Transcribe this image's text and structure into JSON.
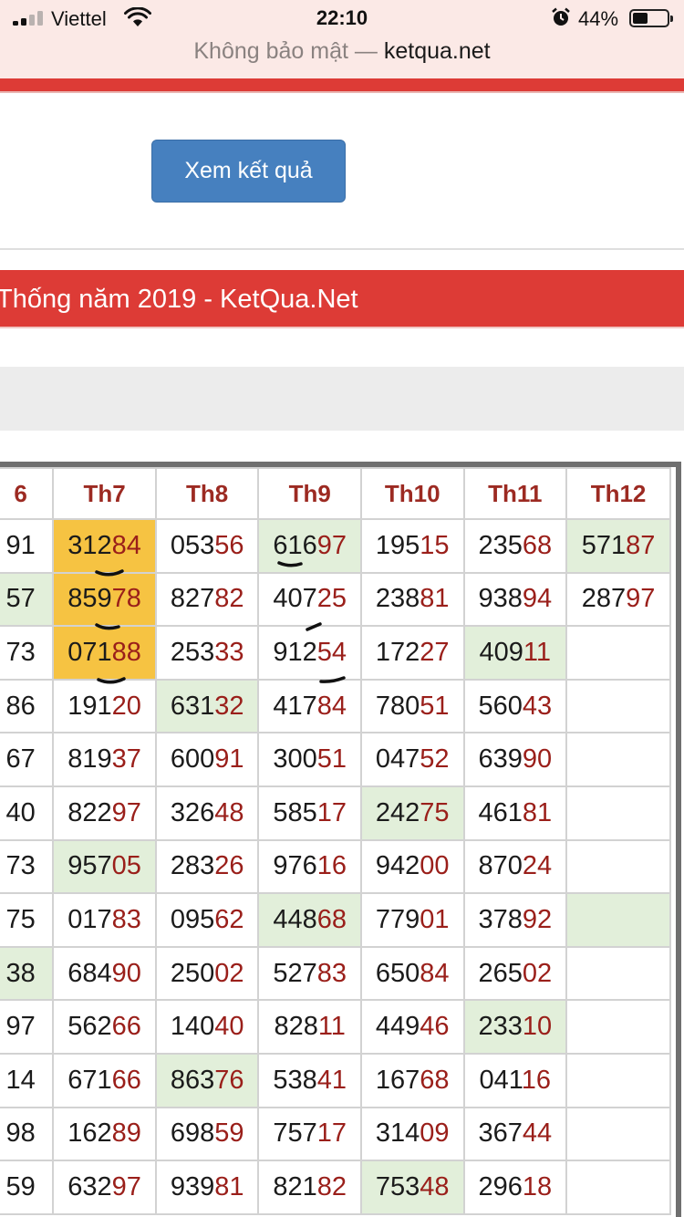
{
  "status": {
    "carrier": "Viettel",
    "time": "22:10",
    "battery": "44%",
    "icons": [
      "signal-icon",
      "wifi-icon",
      "alarm-icon",
      "battery-icon"
    ]
  },
  "browser": {
    "insecure_label": "Không bảo mật —",
    "domain": "ketqua.net"
  },
  "form": {
    "view_button_label": "Xem kết quả"
  },
  "section": {
    "title": "Thống năm 2019 - KetQua.Net"
  },
  "table": {
    "headers": [
      "6",
      "Th7",
      "Th8",
      "Th9",
      "Th10",
      "Th11",
      "Th12"
    ],
    "rows": [
      [
        {
          "v": "91",
          "b": ""
        },
        {
          "v": "312",
          "b": "84",
          "h": "yellow"
        },
        {
          "v": "053",
          "b": "56"
        },
        {
          "v": "616",
          "b": "97",
          "h": "green"
        },
        {
          "v": "195",
          "b": "15"
        },
        {
          "v": "235",
          "b": "68"
        },
        {
          "v": "571",
          "b": "87",
          "h": "green"
        }
      ],
      [
        {
          "v": "57",
          "b": "",
          "h": "green"
        },
        {
          "v": "859",
          "b": "78",
          "h": "yellow"
        },
        {
          "v": "827",
          "b": "82"
        },
        {
          "v": "407",
          "b": "25"
        },
        {
          "v": "238",
          "b": "81"
        },
        {
          "v": "938",
          "b": "94"
        },
        {
          "v": "287",
          "b": "97"
        }
      ],
      [
        {
          "v": "73",
          "b": ""
        },
        {
          "v": "071",
          "b": "88",
          "h": "yellow"
        },
        {
          "v": "253",
          "b": "33"
        },
        {
          "v": "912",
          "b": "54"
        },
        {
          "v": "172",
          "b": "27"
        },
        {
          "v": "409",
          "b": "11",
          "h": "green"
        },
        {
          "v": "",
          "b": ""
        }
      ],
      [
        {
          "v": "86",
          "b": ""
        },
        {
          "v": "191",
          "b": "20"
        },
        {
          "v": "631",
          "b": "32",
          "h": "green"
        },
        {
          "v": "417",
          "b": "84"
        },
        {
          "v": "780",
          "b": "51"
        },
        {
          "v": "560",
          "b": "43"
        },
        {
          "v": "",
          "b": ""
        }
      ],
      [
        {
          "v": "67",
          "b": ""
        },
        {
          "v": "819",
          "b": "37"
        },
        {
          "v": "600",
          "b": "91"
        },
        {
          "v": "300",
          "b": "51"
        },
        {
          "v": "047",
          "b": "52"
        },
        {
          "v": "639",
          "b": "90"
        },
        {
          "v": "",
          "b": ""
        }
      ],
      [
        {
          "v": "40",
          "b": ""
        },
        {
          "v": "822",
          "b": "97"
        },
        {
          "v": "326",
          "b": "48"
        },
        {
          "v": "585",
          "b": "17"
        },
        {
          "v": "242",
          "b": "75",
          "h": "green"
        },
        {
          "v": "461",
          "b": "81"
        },
        {
          "v": "",
          "b": ""
        }
      ],
      [
        {
          "v": "73",
          "b": ""
        },
        {
          "v": "957",
          "b": "05",
          "h": "green"
        },
        {
          "v": "283",
          "b": "26"
        },
        {
          "v": "976",
          "b": "16"
        },
        {
          "v": "942",
          "b": "00"
        },
        {
          "v": "870",
          "b": "24"
        },
        {
          "v": "",
          "b": ""
        }
      ],
      [
        {
          "v": "75",
          "b": ""
        },
        {
          "v": "017",
          "b": "83"
        },
        {
          "v": "095",
          "b": "62"
        },
        {
          "v": "448",
          "b": "68",
          "h": "green"
        },
        {
          "v": "779",
          "b": "01"
        },
        {
          "v": "378",
          "b": "92"
        },
        {
          "v": "",
          "b": "",
          "h": "green"
        }
      ],
      [
        {
          "v": "38",
          "b": "",
          "h": "green"
        },
        {
          "v": "684",
          "b": "90"
        },
        {
          "v": "250",
          "b": "02"
        },
        {
          "v": "527",
          "b": "83"
        },
        {
          "v": "650",
          "b": "84"
        },
        {
          "v": "265",
          "b": "02"
        },
        {
          "v": "",
          "b": ""
        }
      ],
      [
        {
          "v": "97",
          "b": ""
        },
        {
          "v": "562",
          "b": "66"
        },
        {
          "v": "140",
          "b": "40"
        },
        {
          "v": "828",
          "b": "11"
        },
        {
          "v": "449",
          "b": "46"
        },
        {
          "v": "233",
          "b": "10",
          "h": "green"
        },
        {
          "v": "",
          "b": ""
        }
      ],
      [
        {
          "v": "14",
          "b": ""
        },
        {
          "v": "671",
          "b": "66"
        },
        {
          "v": "863",
          "b": "76",
          "h": "green"
        },
        {
          "v": "538",
          "b": "41"
        },
        {
          "v": "167",
          "b": "68"
        },
        {
          "v": "041",
          "b": "16"
        },
        {
          "v": "",
          "b": ""
        }
      ],
      [
        {
          "v": "98",
          "b": ""
        },
        {
          "v": "162",
          "b": "89"
        },
        {
          "v": "698",
          "b": "59"
        },
        {
          "v": "757",
          "b": "17"
        },
        {
          "v": "314",
          "b": "09"
        },
        {
          "v": "367",
          "b": "44"
        },
        {
          "v": "",
          "b": ""
        }
      ],
      [
        {
          "v": "59",
          "b": ""
        },
        {
          "v": "632",
          "b": "97"
        },
        {
          "v": "939",
          "b": "81"
        },
        {
          "v": "821",
          "b": "82"
        },
        {
          "v": "753",
          "b": "48",
          "h": "green"
        },
        {
          "v": "296",
          "b": "18"
        },
        {
          "v": "",
          "b": ""
        }
      ]
    ]
  },
  "colors": {
    "brand_red": "#dd3b36",
    "button_blue": "#4680bf",
    "cell_green": "#e2efda",
    "cell_yellow": "#f6c342",
    "tail_red": "#9a1f1a"
  }
}
